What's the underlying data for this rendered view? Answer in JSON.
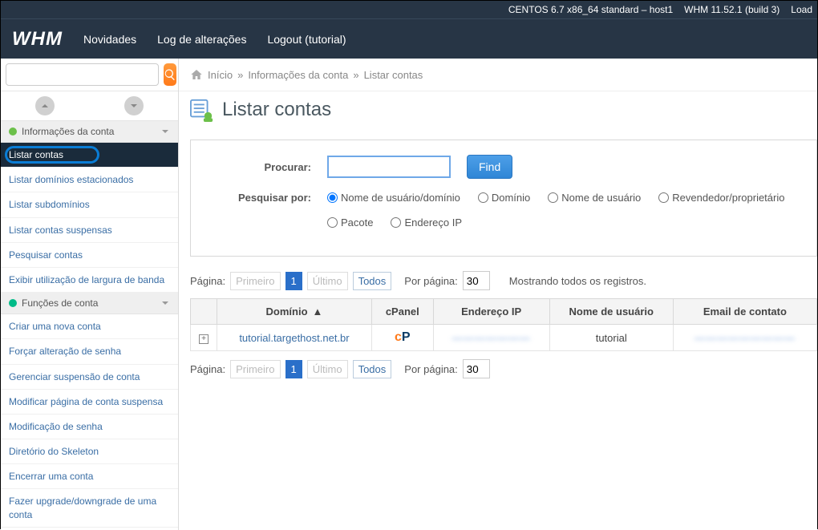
{
  "topbar": {
    "server": "CENTOS 6.7 x86_64 standard – host1",
    "version": "WHM 11.52.1 (build 3)",
    "load": "Load"
  },
  "nav": {
    "logo": "WHM",
    "links": [
      "Novidades",
      "Log de alterações",
      "Logout (tutorial)"
    ]
  },
  "search": {
    "placeholder": ""
  },
  "crumbs": {
    "home": "Início",
    "sep": "»",
    "mid": "Informações da conta",
    "last": "Listar contas"
  },
  "title": "Listar contas",
  "form": {
    "search_label": "Procurar:",
    "find": "Find",
    "searchby_label": "Pesquisar por:",
    "radios": [
      {
        "label": "Nome de usuário/domínio",
        "checked": true
      },
      {
        "label": "Domínio",
        "checked": false
      },
      {
        "label": "Nome de usuário",
        "checked": false
      },
      {
        "label": "Revendedor/proprietário",
        "checked": false
      },
      {
        "label": "Pacote",
        "checked": false
      },
      {
        "label": "Endereço IP",
        "checked": false
      }
    ]
  },
  "pager": {
    "label": "Página:",
    "first": "Primeiro",
    "page": "1",
    "last": "Último",
    "all": "Todos",
    "perpage_label": "Por página:",
    "perpage": "30",
    "showing": "Mostrando todos os registros."
  },
  "table": {
    "cols": [
      "",
      "Domínio",
      "cPanel",
      "Endereço IP",
      "Nome de usuário",
      "Email de contato"
    ],
    "rows": [
      {
        "domain": "tutorial.targethost.net.br",
        "ip": "———————",
        "user": "tutorial",
        "email": "—————————"
      }
    ]
  },
  "sidebar": {
    "sections": [
      {
        "title": "Informações da conta",
        "items": [
          "Listar contas",
          "Listar domínios estacionados",
          "Listar subdomínios",
          "Listar contas suspensas",
          "Pesquisar contas",
          "Exibir utilização de largura de banda"
        ],
        "active": 0
      },
      {
        "title": "Funções de conta",
        "items": [
          "Criar uma nova conta",
          "Forçar alteração de senha",
          "Gerenciar suspensão de conta",
          "Modificar página de conta suspensa",
          "Modificação de senha",
          "Diretório do Skeleton",
          "Encerrar uma conta",
          "Fazer upgrade/downgrade de uma conta"
        ]
      }
    ]
  }
}
